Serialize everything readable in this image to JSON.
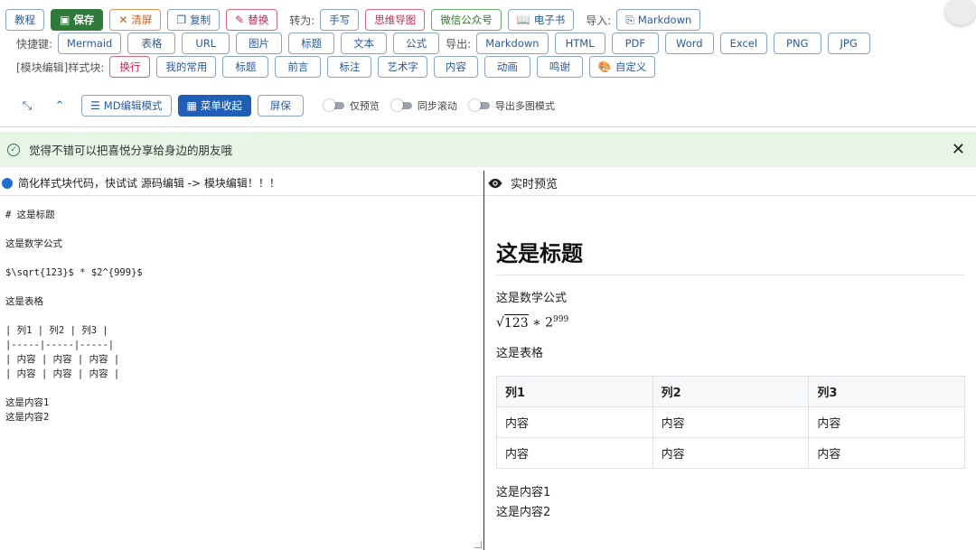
{
  "toolbar": {
    "row1": {
      "tutorial": "教程",
      "save": "保存",
      "clear": "清屏",
      "copy": "复制",
      "replace": "替换",
      "convert_label": "转为:",
      "convert": [
        "手写",
        "思维导图",
        "微信公众号",
        "电子书"
      ],
      "import_label": "导入:",
      "import_markdown": "Markdown"
    },
    "row2": {
      "shortcut_label": "快捷键:",
      "shortcuts": [
        "Mermaid",
        "表格",
        "URL",
        "图片",
        "标题",
        "文本",
        "公式"
      ],
      "export_label": "导出:",
      "exports": [
        "Markdown",
        "HTML",
        "PDF",
        "Word",
        "Excel",
        "PNG",
        "JPG"
      ]
    },
    "row3": {
      "block_label": "[模块编辑]样式块:",
      "blocks": [
        "换行",
        "我的常用",
        "标题",
        "前言",
        "标注",
        "艺术字",
        "内容",
        "动画",
        "鸣谢"
      ],
      "custom": "自定义"
    },
    "row4": {
      "md_mode": "MD编辑模式",
      "menu_collapse": "菜单收起",
      "screen": "屏保",
      "preview_only": "仅预览",
      "sync_scroll": "同步滚动",
      "export_multi": "导出多图模式"
    }
  },
  "notice": {
    "text": "觉得不错可以把喜悦分享给身边的朋友哦"
  },
  "editor": {
    "hint": "简化样式块代码，快试试 源码编辑 -> 模块编辑！！！",
    "lines": [
      "# 这是标题",
      "",
      "这是数学公式",
      "",
      "$\\sqrt{123}$ * $2^{999}$",
      "",
      "这是表格",
      "",
      "| 列1 | 列2 | 列3 |",
      "|-----|-----|-----|",
      "| 内容 | 内容 | 内容 |",
      "| 内容 | 内容 | 内容 |",
      "",
      "这是内容1",
      "这是内容2"
    ]
  },
  "preview": {
    "title": "实时预览",
    "h1": "这是标题",
    "p_math": "这是数学公式",
    "math_radicand": "123",
    "math_base": "2",
    "math_exp": "999",
    "p_table": "这是表格",
    "table": {
      "headers": [
        "列1",
        "列2",
        "列3"
      ],
      "rows": [
        [
          "内容",
          "内容",
          "内容"
        ],
        [
          "内容",
          "内容",
          "内容"
        ]
      ]
    },
    "content1": "这是内容1",
    "content2": "这是内容2"
  }
}
